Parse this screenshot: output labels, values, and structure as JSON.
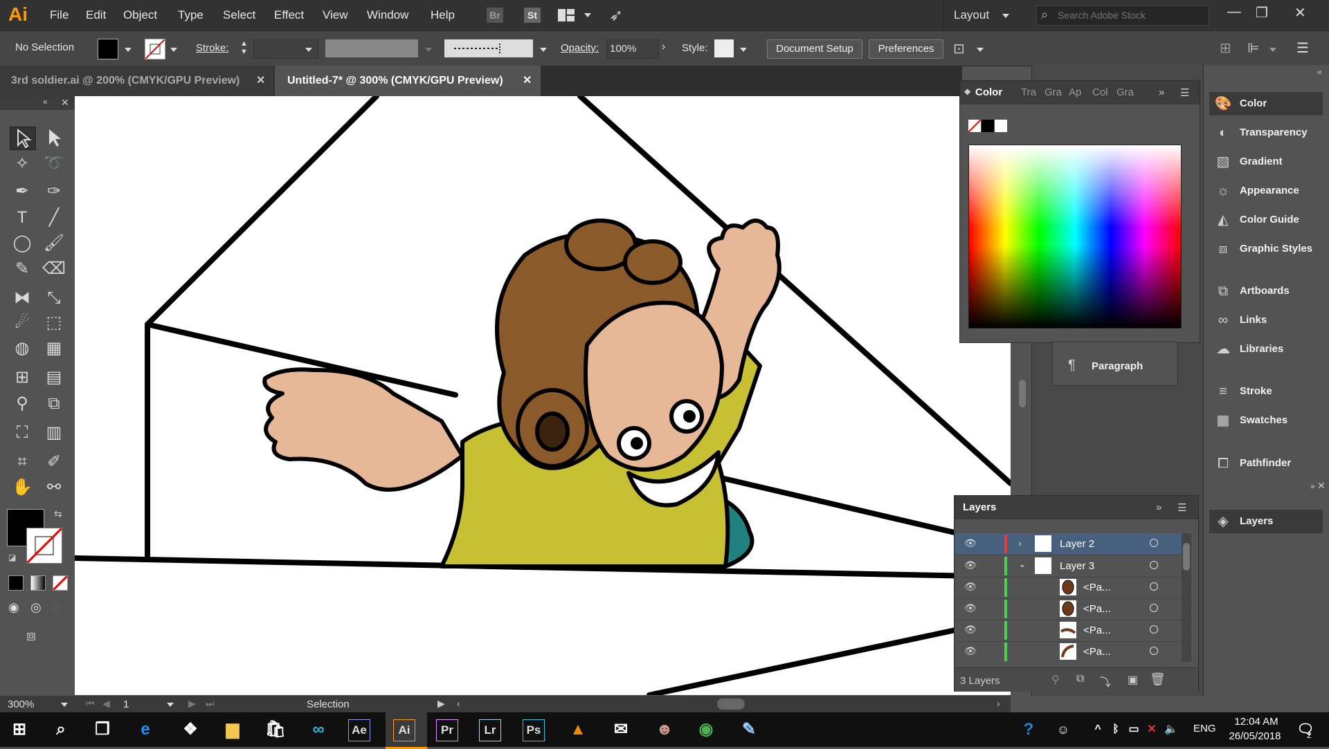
{
  "app": {
    "logo": "Ai",
    "workspace": "Layout",
    "search_placeholder": "Search Adobe Stock"
  },
  "menu": [
    "File",
    "Edit",
    "Object",
    "Type",
    "Select",
    "Effect",
    "View",
    "Window",
    "Help"
  ],
  "menu_icons": {
    "bridge": "Br",
    "stock": "St"
  },
  "control": {
    "selection": "No Selection",
    "stroke_label": "Stroke:",
    "opacity_label": "Opacity:",
    "opacity_value": "100%",
    "style_label": "Style:",
    "document_setup": "Document Setup",
    "preferences": "Preferences"
  },
  "tabs": [
    {
      "label": "3rd soldier.ai @ 200% (CMYK/GPU Preview)",
      "active": false
    },
    {
      "label": "Untitled-7* @ 300% (CMYK/GPU Preview)",
      "active": true
    }
  ],
  "color_panel": {
    "title": "Color",
    "other_tabs": [
      "Tra",
      "Gra",
      "Ap",
      "Col",
      "Gra"
    ]
  },
  "behind_panel": {
    "paragraph": "Paragraph"
  },
  "dock": [
    {
      "label": "Color",
      "icon": "palette-icon"
    },
    {
      "label": "Transparency",
      "icon": "transparency-icon"
    },
    {
      "label": "Gradient",
      "icon": "gradient-icon"
    },
    {
      "label": "Appearance",
      "icon": "sun-icon"
    },
    {
      "label": "Color Guide",
      "icon": "color-guide-icon"
    },
    {
      "label": "Graphic Styles",
      "icon": "graphic-styles-icon"
    },
    {
      "label": "Artboards",
      "icon": "artboards-icon"
    },
    {
      "label": "Links",
      "icon": "link-icon"
    },
    {
      "label": "Libraries",
      "icon": "libraries-icon"
    },
    {
      "label": "Stroke",
      "icon": "stroke-icon"
    },
    {
      "label": "Swatches",
      "icon": "swatches-icon"
    },
    {
      "label": "Pathfinder",
      "icon": "pathfinder-icon"
    },
    {
      "label": "Layers",
      "icon": "layers-icon"
    }
  ],
  "layers_panel": {
    "title": "Layers",
    "count": "3 Layers",
    "rows": [
      {
        "name": "Layer 2",
        "color": "#e9393a",
        "selected": true,
        "expanded": false
      },
      {
        "name": "Layer 3",
        "color": "#4dd04d",
        "selected": false,
        "expanded": true
      },
      {
        "name": "<Pa...",
        "color": "#4dd04d",
        "selected": false,
        "sub": true
      },
      {
        "name": "<Pa...",
        "color": "#4dd04d",
        "selected": false,
        "sub": true
      },
      {
        "name": "<Pa...",
        "color": "#4dd04d",
        "selected": false,
        "sub": true
      },
      {
        "name": "<Pa...",
        "color": "#4dd04d",
        "selected": false,
        "sub": true
      }
    ]
  },
  "status": {
    "zoom": "300%",
    "artboard": "1",
    "tool": "Selection"
  },
  "taskbar": {
    "apps": [
      {
        "label": "Ae",
        "color": "#9999ff",
        "bg": "#1f0740"
      },
      {
        "label": "Ai",
        "color": "#ff9a00",
        "bg": "#330000"
      },
      {
        "label": "Pr",
        "color": "#e98cff",
        "bg": "#2a0634"
      },
      {
        "label": "Lr",
        "color": "#add5ec",
        "bg": "#1c2f3e"
      },
      {
        "label": "Ps",
        "color": "#31c5f0",
        "bg": "#001d26"
      }
    ],
    "lang": "ENG",
    "time": "12:04 AM",
    "date": "26/05/2018",
    "notifications": "2"
  },
  "colors": {
    "accent": "#ff9a00",
    "canvas": "#ffffff",
    "panel": "#535353",
    "shirt": "#c8c033",
    "skin": "#e6b898",
    "helmet": "#8b5a2b",
    "pants": "#218080"
  }
}
